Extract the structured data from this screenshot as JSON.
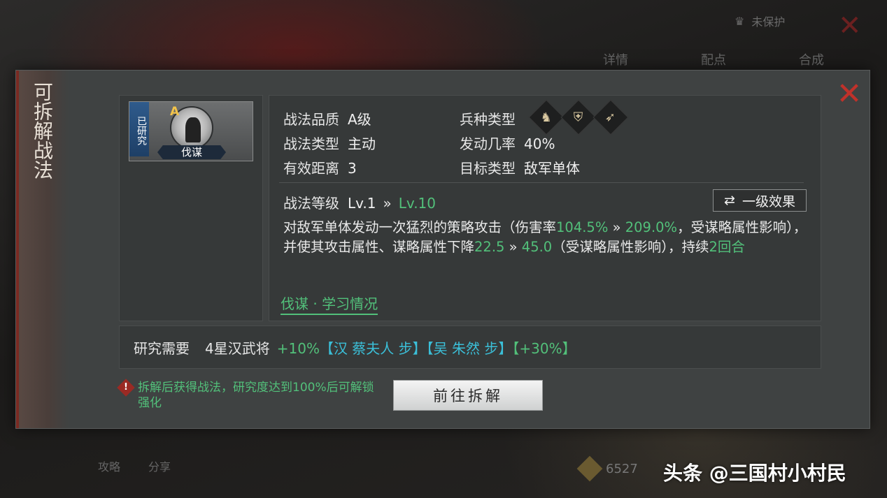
{
  "background": {
    "tabs": [
      "详情",
      "配点",
      "合成"
    ],
    "top_right_label": "未保护",
    "bottom_items": [
      "攻略",
      "分享"
    ],
    "currency_value": "6527"
  },
  "modal": {
    "side_title": "可拆解战法",
    "skill": {
      "researched_tag": "已研究",
      "grade": "A",
      "name": "伐谋"
    },
    "info": {
      "quality_label": "战法品质",
      "quality_value": "A级",
      "troop_label": "兵种类型",
      "troop_icons": [
        "cavalry-icon",
        "shield-icon",
        "bow-icon"
      ],
      "type_label": "战法类型",
      "type_value": "主动",
      "rate_label": "发动几率",
      "rate_value": "40%",
      "range_label": "有效距离",
      "range_value": "3",
      "target_label": "目标类型",
      "target_value": "敌军单体"
    },
    "level": {
      "label": "战法等级",
      "from": "Lv.1",
      "arrow": "»",
      "to": "Lv.10",
      "effect_button": "一级效果"
    },
    "description": {
      "p1": "对敌军单体发动一次猛烈的策略攻击（伤害率",
      "v1a": "104.5%",
      "arrow": "»",
      "v1b": "209.0%",
      "p2": "，受谋略属性影响），并使其攻击属性、谋略属性下降",
      "v2a": "22.5",
      "v2b": "45.0",
      "p3": "（受谋略属性影响），持续",
      "v3": "2回合"
    },
    "study_link": "伐谋 · 学习情况",
    "research": {
      "label": "研究需要",
      "general": "4星汉武将",
      "bonus1": "+10%",
      "tag1": "【汉 蔡夫人 步】",
      "tag2": "【吴 朱然 步】",
      "tag3": "【+30%】"
    },
    "warning": "拆解后获得战法，研究度达到100%后可解锁强化",
    "go_button": "前往拆解"
  },
  "watermark": "头条 @三国村小村民",
  "colors": {
    "accent_green": "#52c07a",
    "accent_cyan": "#3bbfd8",
    "close_red": "#c0312a"
  }
}
